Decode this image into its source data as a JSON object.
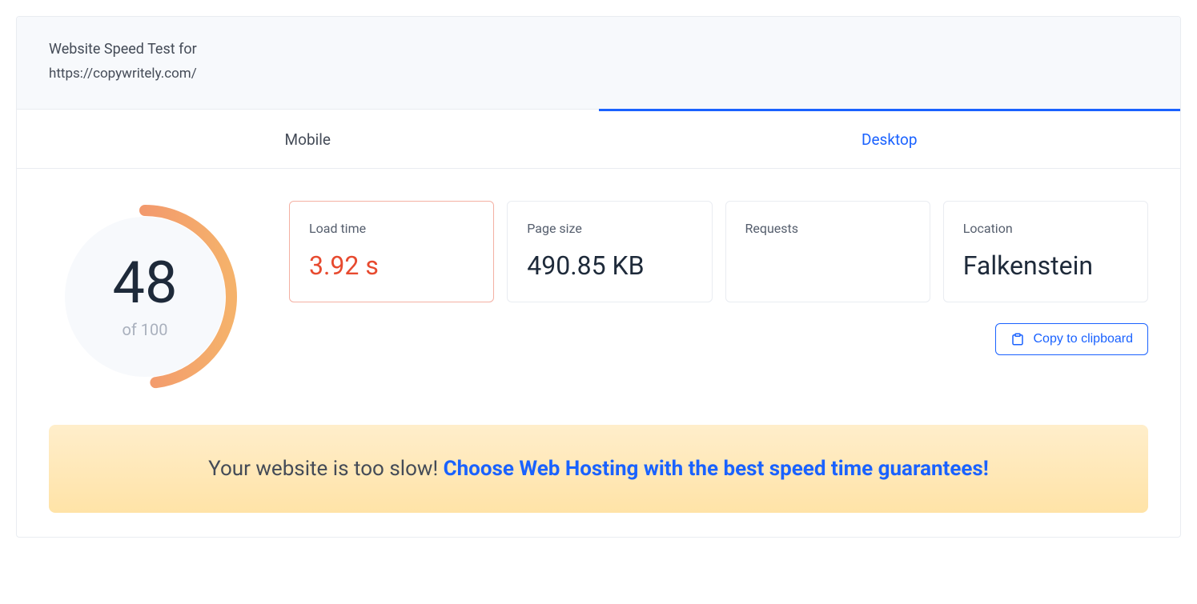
{
  "header": {
    "title": "Website Speed Test for",
    "url": "https://copywritely.com/"
  },
  "tabs": [
    {
      "label": "Mobile",
      "active": false
    },
    {
      "label": "Desktop",
      "active": true
    }
  ],
  "gauge": {
    "score": "48",
    "of_max": "of 100",
    "percent": 48
  },
  "metrics": [
    {
      "label": "Load time",
      "value": "3.92 s",
      "highlight": true
    },
    {
      "label": "Page size",
      "value": "490.85 KB",
      "highlight": false
    },
    {
      "label": "Requests",
      "value": "",
      "highlight": false
    },
    {
      "label": "Location",
      "value": "Falkenstein",
      "highlight": false
    }
  ],
  "copy_button": "Copy to clipboard",
  "banner": {
    "lead": "Your website is too slow! ",
    "cta": "Choose Web Hosting with the best speed time guarantees!"
  }
}
